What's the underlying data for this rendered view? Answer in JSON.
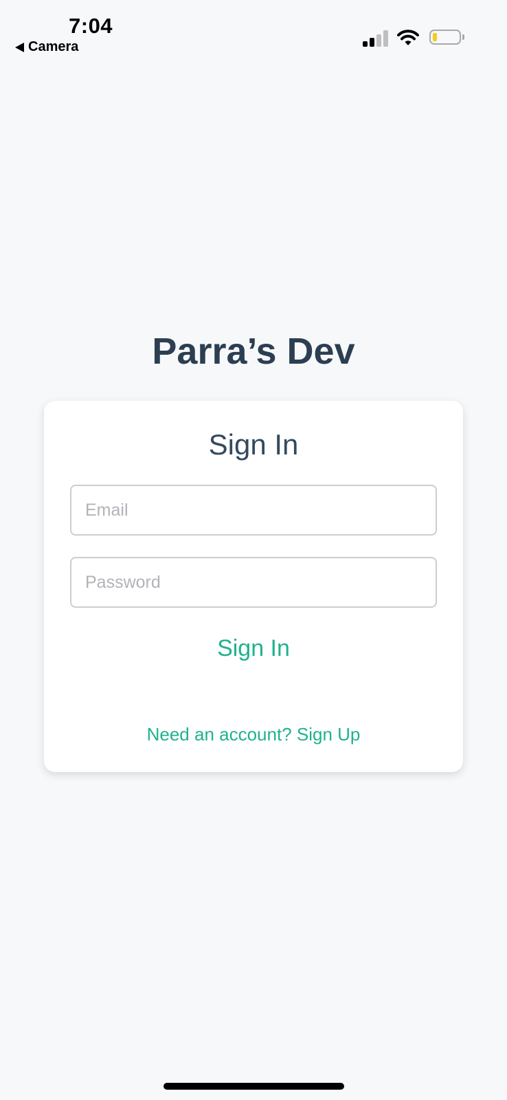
{
  "status_bar": {
    "time": "7:04",
    "back_label": "Camera",
    "signal_strength": 2,
    "signal_max": 4,
    "battery_level": 0.1,
    "battery_color": "#f5cc1c",
    "icons": [
      "back-arrow-icon",
      "signal-icon",
      "wifi-icon",
      "battery-icon"
    ]
  },
  "app": {
    "title": "Parra’s Dev"
  },
  "signin_card": {
    "title": "Sign In",
    "email_placeholder": "Email",
    "email_value": "",
    "password_placeholder": "Password",
    "password_value": "",
    "submit_label": "Sign In",
    "signup_link": "Need an account? Sign Up"
  },
  "colors": {
    "background": "#f7f8fa",
    "title": "#2c3e52",
    "accent": "#1fb28f",
    "field_border": "#c9ced3"
  }
}
